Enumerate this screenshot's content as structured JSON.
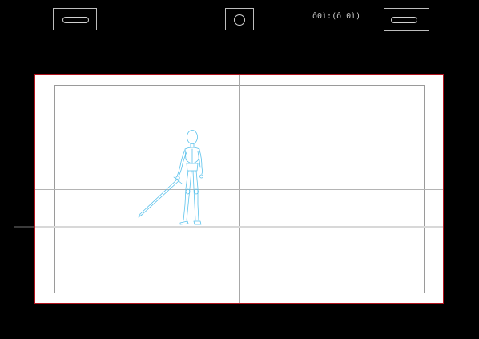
{
  "toolbar": {
    "left_button_icon": "pill-icon",
    "center_button_icon": "circle-icon",
    "right_button_icon": "pill-icon",
    "timecode": "ô0ì:(ô 0ì)"
  },
  "canvas": {
    "background": "#ffffff",
    "border_color": "#b0141e",
    "guide_color": "#a8a8a8",
    "sketch_color": "#5bc2ec"
  }
}
